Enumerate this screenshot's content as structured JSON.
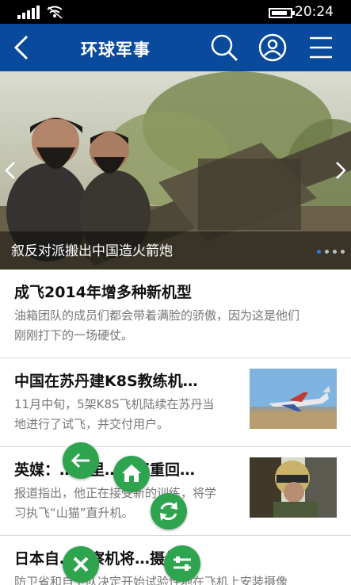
{
  "status": {
    "time": "20:24"
  },
  "header": {
    "title": "环球军事"
  },
  "hero": {
    "caption": "叙反对派搬出中国造火箭炮",
    "slides": 4,
    "active_slide": 1
  },
  "articles": [
    {
      "title": "成飞2014年增多种新机型",
      "desc1": "油箱团队的成员们都会带着满脸的骄傲，因为这是他们",
      "desc2": "刚刚打下的一场硬仗。",
      "thumb": false
    },
    {
      "title": "中国在苏丹建K8S教练机…",
      "desc1": "11月中旬，5架K8S飞机陆续在苏丹当",
      "desc2": "地进行了试飞，并交付用户。",
      "thumb": true
    },
    {
      "title": "英媒：…哈里…子将重回…",
      "desc1": "报道指出，他正在接受新的训练，将学",
      "desc2": "习执飞“山猫”直升机。",
      "thumb": true
    },
    {
      "title": "日本自…侦察机将…摄像头",
      "desc1": "防卫省和自卫队决定开始试验性地在飞机上安装摄像",
      "desc2": "",
      "thumb": false
    }
  ],
  "icons": {
    "back": "chevron-left-icon",
    "search": "search-icon",
    "account": "user-icon",
    "menu": "menu-icon",
    "fab_back": "arrow-left-icon",
    "fab_home": "home-icon",
    "fab_refresh": "refresh-icon",
    "fab_close": "close-icon",
    "fab_settings": "sliders-icon"
  },
  "colors": {
    "header": "#0a4a9c",
    "fab": "#2ea44f",
    "dot_active": "#2b7be4"
  }
}
